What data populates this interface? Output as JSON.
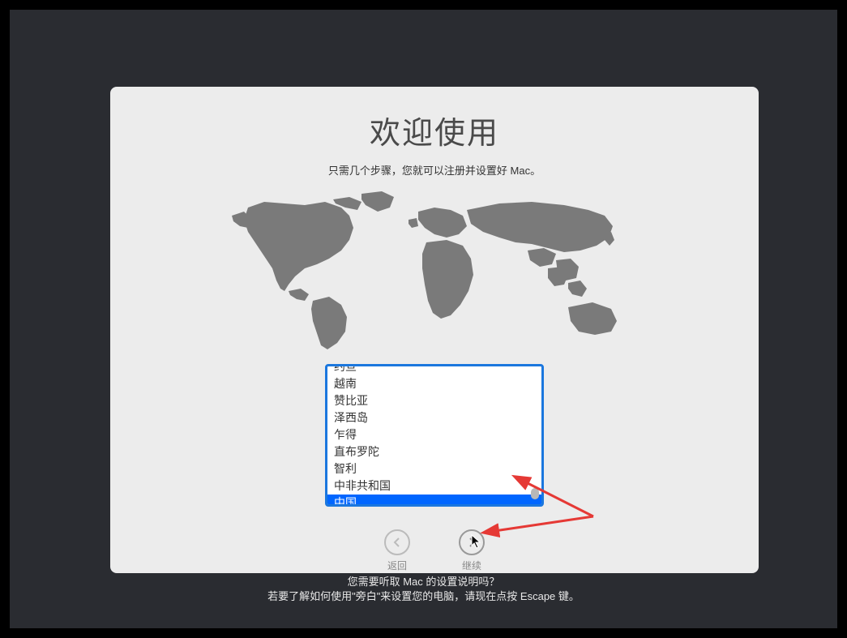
{
  "dialog": {
    "title": "欢迎使用",
    "subtitle": "只需几个步骤，您就可以注册并设置好 Mac。"
  },
  "countries": {
    "items": [
      {
        "label": "约旦",
        "selected": false,
        "partial": true
      },
      {
        "label": "越南",
        "selected": false,
        "partial": false
      },
      {
        "label": "赞比亚",
        "selected": false,
        "partial": false
      },
      {
        "label": "泽西岛",
        "selected": false,
        "partial": false
      },
      {
        "label": "乍得",
        "selected": false,
        "partial": false
      },
      {
        "label": "直布罗陀",
        "selected": false,
        "partial": false
      },
      {
        "label": "智利",
        "selected": false,
        "partial": false
      },
      {
        "label": "中非共和国",
        "selected": false,
        "partial": false
      },
      {
        "label": "中国",
        "selected": true,
        "partial": false
      }
    ]
  },
  "buttons": {
    "back": {
      "label": "返回"
    },
    "continue": {
      "label": "继续"
    }
  },
  "help": {
    "line1": "您需要听取 Mac 的设置说明吗？",
    "line2": "若要了解如何使用\"旁白\"来设置您的电脑，请现在点按 Escape 键。"
  }
}
